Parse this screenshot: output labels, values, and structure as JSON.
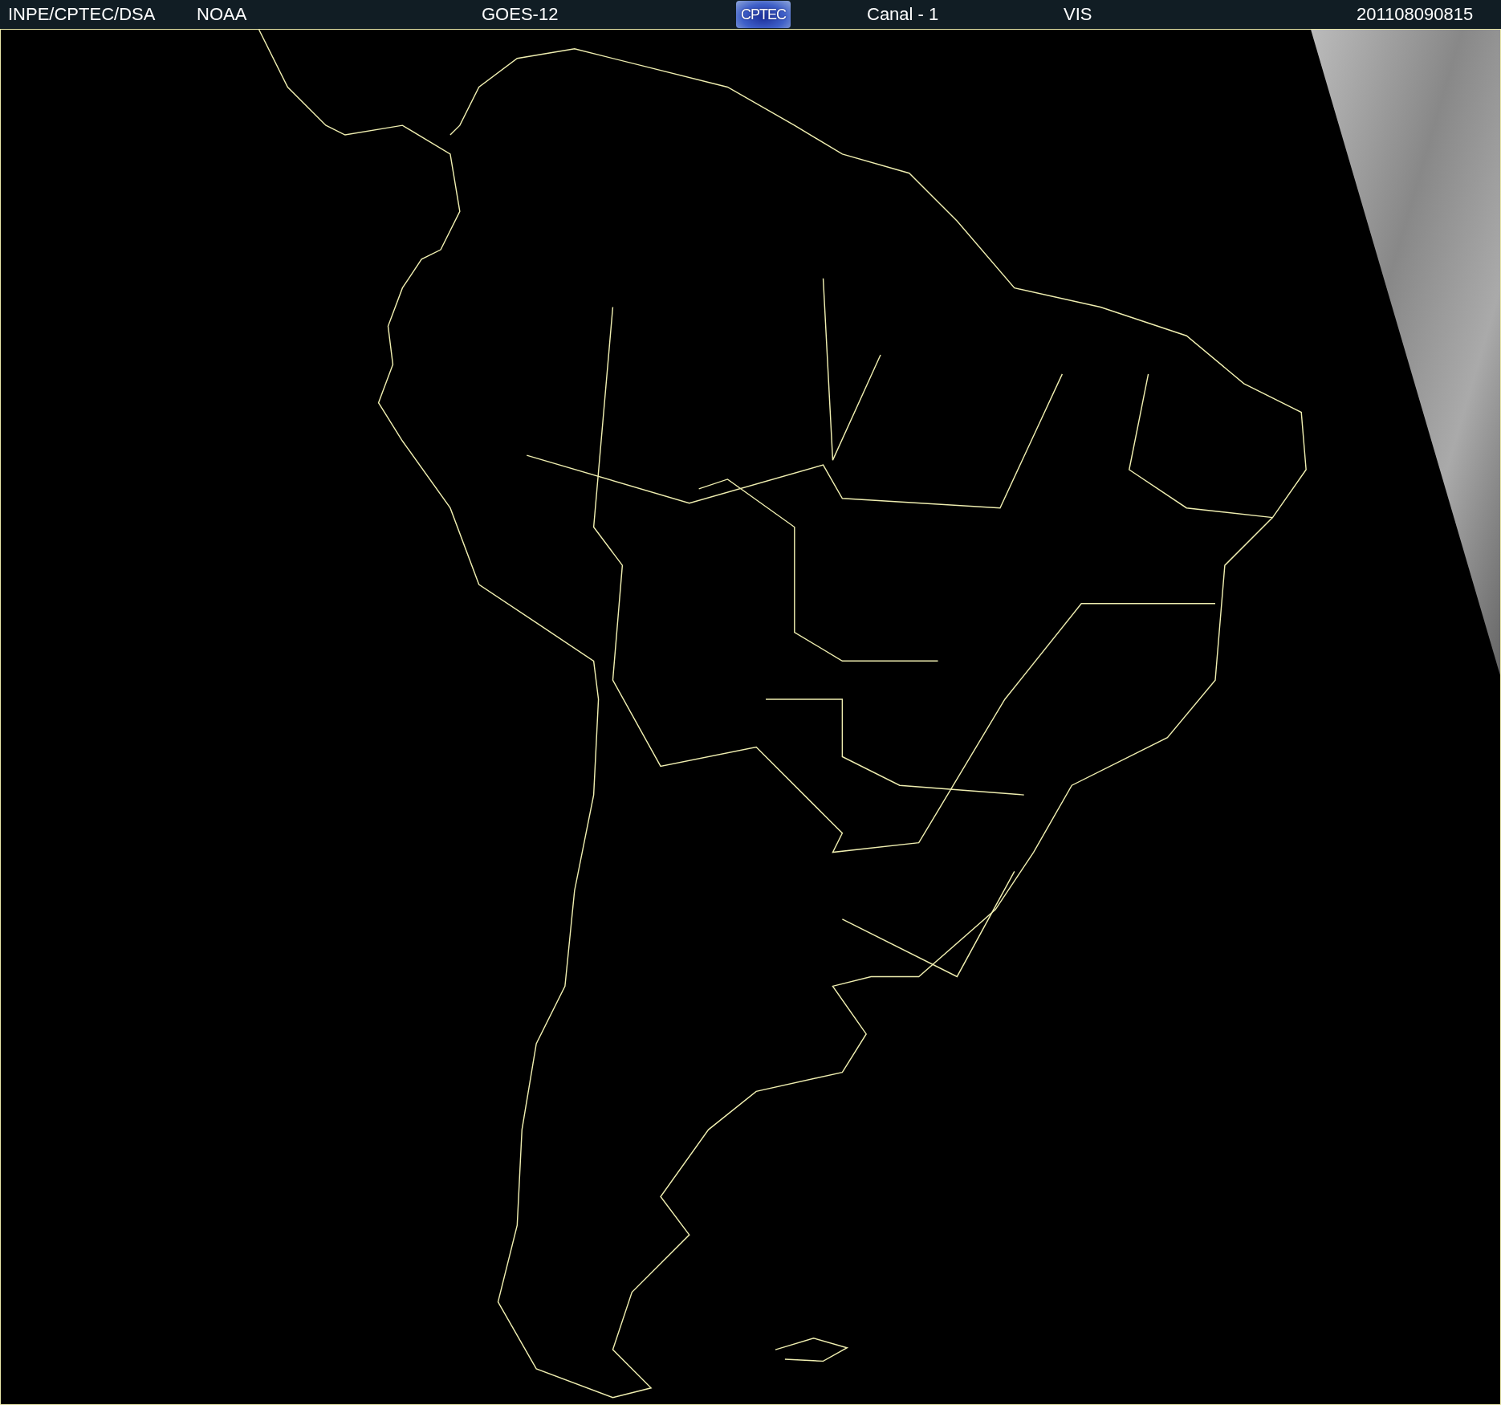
{
  "header": {
    "items": [
      {
        "kind": "text",
        "text": "INPE/CPTEC/DSA"
      },
      {
        "kind": "text",
        "text": "NOAA"
      },
      {
        "kind": "text",
        "text": "GOES-12"
      },
      {
        "kind": "logo",
        "text": "CPTEC"
      },
      {
        "kind": "text",
        "text": "Canal - 1"
      },
      {
        "kind": "text",
        "text": "VIS"
      },
      {
        "kind": "text",
        "text": "201108090815"
      }
    ]
  }
}
